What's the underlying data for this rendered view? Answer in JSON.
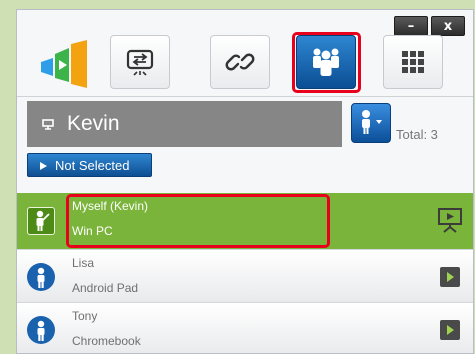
{
  "window": {
    "minimize_label": "–",
    "close_label": "x"
  },
  "toolbar": {
    "tools": [
      {
        "icon": "screen-share-icon",
        "active": false
      },
      {
        "icon": "link-icon",
        "active": false
      },
      {
        "icon": "people-group-icon",
        "active": true
      },
      {
        "icon": "grid-icon",
        "active": false
      }
    ]
  },
  "presenter": {
    "name": "Kevin",
    "total": "Total: 3"
  },
  "selection": {
    "button_label": "Not Selected"
  },
  "users": [
    {
      "name": "Myself (Kevin)",
      "device": "Win PC",
      "status": "presenting",
      "highlighted": true
    },
    {
      "name": "Lisa",
      "device": "Android Pad",
      "status": "idle"
    },
    {
      "name": "Tony",
      "device": "Chromebook",
      "status": "idle"
    }
  ],
  "colors": {
    "accent_blue": "#1565b8",
    "active_row": "#7ab43a",
    "highlight": "#e8001c"
  }
}
